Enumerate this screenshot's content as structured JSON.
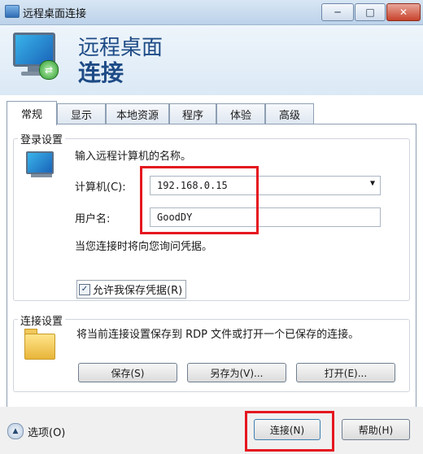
{
  "window": {
    "title": "远程桌面连接",
    "controls": {
      "minimize": "─",
      "maximize": "□",
      "close": "✕"
    }
  },
  "header": {
    "line1": "远程桌面",
    "line2": "连接"
  },
  "tabs": [
    {
      "label": "常规",
      "active": true
    },
    {
      "label": "显示"
    },
    {
      "label": "本地资源"
    },
    {
      "label": "程序"
    },
    {
      "label": "体验"
    },
    {
      "label": "高级"
    }
  ],
  "login": {
    "group_label": "登录设置",
    "instruction": "输入远程计算机的名称。",
    "computer_label": "计算机(C):",
    "computer_value": "192.168.0.15",
    "username_label": "用户名:",
    "username_value": "GoodDY",
    "credentials_note": "当您连接时将向您询问凭据。",
    "save_credentials_label": "允许我保存凭据(R)",
    "save_credentials_checked": true
  },
  "connection": {
    "group_label": "连接设置",
    "description": "将当前连接设置保存到 RDP 文件或打开一个已保存的连接。",
    "save_label": "保存(S)",
    "save_as_label": "另存为(V)...",
    "open_label": "打开(E)..."
  },
  "footer": {
    "options_label": "选项(O)",
    "connect_label": "连接(N)",
    "help_label": "帮助(H)"
  },
  "colors": {
    "highlight_red": "#e5171f",
    "header_blue": "#1e4b86"
  }
}
